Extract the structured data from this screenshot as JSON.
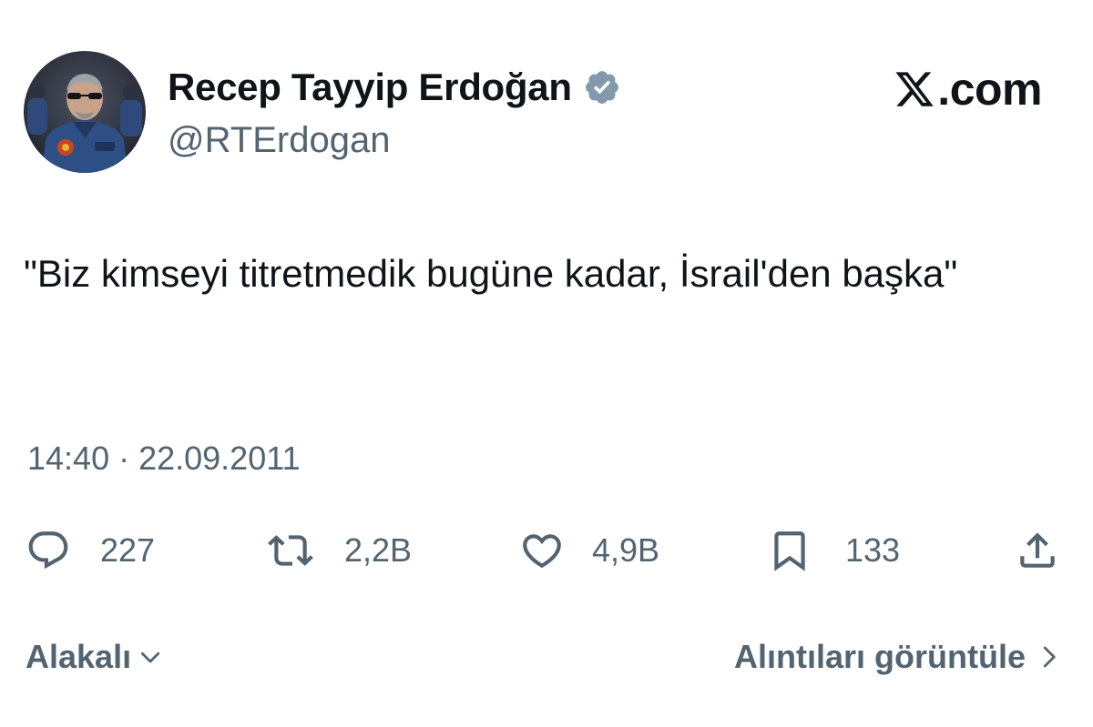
{
  "author": {
    "display_name": "Recep Tayyip Erdoğan",
    "handle": "@RTErdogan",
    "verified_icon": "verified-badge-icon",
    "avatar_icon": "avatar-photo"
  },
  "brand": {
    "logo_icon": "x-logo-icon",
    "suffix": ".com"
  },
  "tweet": {
    "text": "\"Biz kimseyi titretmedik bugüne kadar, İsrail'den başka\"",
    "timestamp": "14:40 · 22.09.2011"
  },
  "actions": {
    "reply": {
      "icon": "reply-icon",
      "count": "227"
    },
    "retweet": {
      "icon": "retweet-icon",
      "count": "2,2B"
    },
    "like": {
      "icon": "heart-icon",
      "count": "4,9B"
    },
    "bookmark": {
      "icon": "bookmark-icon",
      "count": "133"
    },
    "share": {
      "icon": "share-icon"
    }
  },
  "footer": {
    "sort_label": "Alakalı",
    "quotes_label": "Alıntıları görüntüle"
  },
  "colors": {
    "text_primary": "#0f1419",
    "text_secondary": "#536471",
    "background": "#ffffff"
  }
}
